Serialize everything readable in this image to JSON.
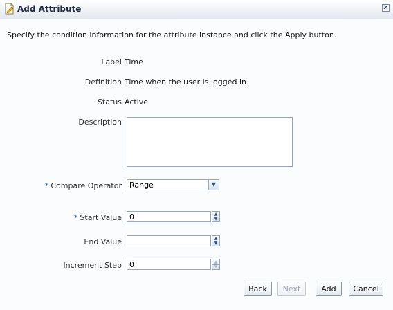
{
  "dialog": {
    "title": "Add Attribute",
    "close_glyph": "✕",
    "instruction": "Specify the condition information for the attribute instance and click the Apply button."
  },
  "fields": {
    "label": {
      "label": "Label",
      "value": "Time"
    },
    "definition": {
      "label": "Definition",
      "value": "Time when the user is logged in"
    },
    "status": {
      "label": "Status",
      "value": "Active"
    },
    "description": {
      "label": "Description",
      "value": ""
    },
    "compare_operator": {
      "required_marker": "*",
      "label": "Compare Operator",
      "value": "Range"
    },
    "start_value": {
      "required_marker": "*",
      "label": "Start Value",
      "value": "0"
    },
    "end_value": {
      "label": "End Value",
      "value": ""
    },
    "increment_step": {
      "label": "Increment Step",
      "value": "0"
    }
  },
  "buttons": {
    "back": "Back",
    "next": "Next",
    "add": "Add",
    "cancel": "Cancel"
  },
  "icons": {
    "title": "edit-document-icon",
    "dropdown": "chevron-down-icon",
    "spin_up": "triangle-up-icon",
    "spin_down": "triangle-down-icon"
  },
  "colors": {
    "required_marker": "#2e6fc0",
    "title_text": "#1e2d44"
  }
}
